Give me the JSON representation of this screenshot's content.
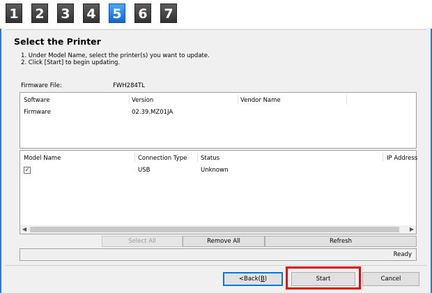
{
  "steps": [
    "1",
    "2",
    "3",
    "4",
    "5",
    "6",
    "7"
  ],
  "active_step": "5",
  "page_title": "Select the Printer",
  "instructions": [
    "1. Under Model Name, select the printer(s) you want to update.",
    "2. Click [Start] to begin updating."
  ],
  "firmware_file": {
    "label": "Firmware File:",
    "value": "FWH284TL"
  },
  "software_table": {
    "headers": [
      "Software",
      "Version",
      "Vendor Name"
    ],
    "rows": [
      {
        "software": "Firmware",
        "version": "02.39.MZ01JA",
        "vendor": ""
      }
    ]
  },
  "printer_table": {
    "headers": [
      "Model Name",
      "Connection Type",
      "Status",
      "IP Address"
    ],
    "rows": [
      {
        "checked": true,
        "model": "",
        "connection": "USB",
        "status": "Unknown",
        "ip": ""
      }
    ]
  },
  "buttons": {
    "select_all": "Select All",
    "remove_all": "Remove All",
    "refresh": "Refresh"
  },
  "status": "Ready",
  "nav": {
    "back_prefix": "<Back(",
    "back_key": "B",
    "back_suffix": ")",
    "start": "Start",
    "cancel": "Cancel"
  },
  "colors": {
    "accent": "#2b78d6",
    "highlight": "#e00000"
  }
}
